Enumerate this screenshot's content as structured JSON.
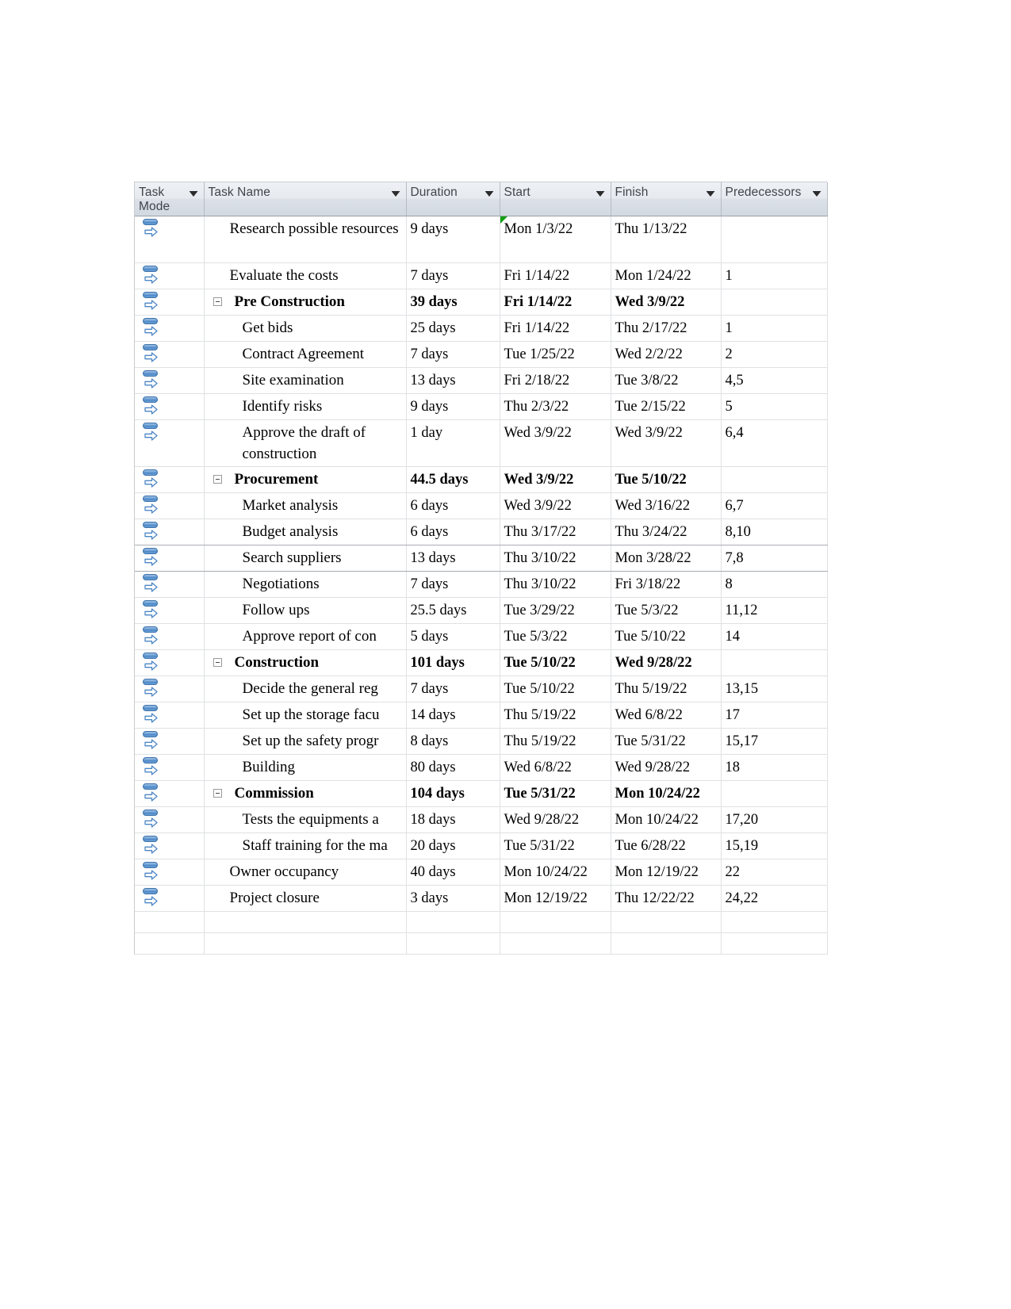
{
  "app": "microsoft-project-entry-table",
  "columns": [
    {
      "key": "mode",
      "label": "Task\nMode",
      "has_filter": true
    },
    {
      "key": "name",
      "label": "Task Name",
      "has_filter": true
    },
    {
      "key": "dur",
      "label": "Duration",
      "has_filter": true
    },
    {
      "key": "start",
      "label": "Start",
      "has_filter": true
    },
    {
      "key": "fin",
      "label": "Finish",
      "has_filter": true
    },
    {
      "key": "pred",
      "label": "Predecessors",
      "has_filter": true
    }
  ],
  "colors": {
    "header_bg": "#dde2e9",
    "header_text": "#40454c",
    "grid_line": "#dfe1e4",
    "icon_blue": "#4d87c6",
    "flag_green": "#11a011"
  },
  "icons": {
    "task_mode": "auto-scheduled-icon",
    "filter": "filter-dropdown-arrow-icon",
    "collapse": "collapse-minus-box-icon",
    "indicator": "green-corner-indicator"
  },
  "rows": [
    {
      "name": "Research possible resources",
      "level": 1,
      "summary": false,
      "wrap": true,
      "dur": "9 days",
      "start": "Mon 1/3/22",
      "finish": "Thu 1/13/22",
      "pred": "",
      "flag": true
    },
    {
      "name": "Evaluate the costs",
      "level": 1,
      "summary": false,
      "wrap": false,
      "dur": "7 days",
      "start": "Fri 1/14/22",
      "finish": "Mon 1/24/22",
      "pred": "1",
      "flag": false
    },
    {
      "name": "Pre Construction",
      "level": 0,
      "summary": true,
      "wrap": false,
      "dur": "39 days",
      "start": "Fri 1/14/22",
      "finish": "Wed 3/9/22",
      "pred": "",
      "flag": false
    },
    {
      "name": "Get bids",
      "level": 2,
      "summary": false,
      "wrap": false,
      "dur": "25 days",
      "start": "Fri 1/14/22",
      "finish": "Thu 2/17/22",
      "pred": "1",
      "flag": false
    },
    {
      "name": "Contract Agreement",
      "level": 2,
      "summary": false,
      "wrap": false,
      "dur": "7 days",
      "start": "Tue 1/25/22",
      "finish": "Wed 2/2/22",
      "pred": "2",
      "flag": false
    },
    {
      "name": "Site examination",
      "level": 2,
      "summary": false,
      "wrap": false,
      "dur": "13 days",
      "start": "Fri 2/18/22",
      "finish": "Tue 3/8/22",
      "pred": "4,5",
      "flag": false
    },
    {
      "name": "Identify risks",
      "level": 2,
      "summary": false,
      "wrap": false,
      "dur": "9 days",
      "start": "Thu 2/3/22",
      "finish": "Tue 2/15/22",
      "pred": "5",
      "flag": false
    },
    {
      "name": "Approve the draft of construction",
      "level": 2,
      "summary": false,
      "wrap": true,
      "dur": "1 day",
      "start": "Wed 3/9/22",
      "finish": "Wed 3/9/22",
      "pred": "6,4",
      "flag": false
    },
    {
      "name": "Procurement",
      "level": 0,
      "summary": true,
      "wrap": false,
      "dur": "44.5 days",
      "start": "Wed 3/9/22",
      "finish": "Tue 5/10/22",
      "pred": "",
      "flag": false
    },
    {
      "name": "Market analysis",
      "level": 2,
      "summary": false,
      "wrap": false,
      "dur": "6 days",
      "start": "Wed 3/9/22",
      "finish": "Wed 3/16/22",
      "pred": "6,7",
      "flag": false
    },
    {
      "name": "Budget analysis",
      "level": 2,
      "summary": false,
      "wrap": false,
      "dur": "6 days",
      "start": "Thu 3/17/22",
      "finish": "Thu 3/24/22",
      "pred": "8,10",
      "flag": false
    },
    {
      "name": "Search suppliers",
      "level": 2,
      "summary": false,
      "wrap": false,
      "dur": "13 days",
      "start": "Thu 3/10/22",
      "finish": "Mon 3/28/22",
      "pred": "7,8",
      "flag": false
    },
    {
      "name": "Negotiations",
      "level": 2,
      "summary": false,
      "wrap": false,
      "dur": "7 days",
      "start": "Thu 3/10/22",
      "finish": "Fri 3/18/22",
      "pred": "8",
      "flag": false
    },
    {
      "name": "Follow ups",
      "level": 2,
      "summary": false,
      "wrap": false,
      "dur": "25.5 days",
      "start": "Tue 3/29/22",
      "finish": "Tue 5/3/22",
      "pred": "11,12",
      "flag": false
    },
    {
      "name": "Approve report of con",
      "level": 2,
      "summary": false,
      "wrap": false,
      "dur": "5 days",
      "start": "Tue 5/3/22",
      "finish": "Tue 5/10/22",
      "pred": "14",
      "flag": false
    },
    {
      "name": "Construction",
      "level": 0,
      "summary": true,
      "wrap": false,
      "dur": "101 days",
      "start": "Tue 5/10/22",
      "finish": "Wed 9/28/22",
      "pred": "",
      "flag": false
    },
    {
      "name": "Decide the general reg",
      "level": 2,
      "summary": false,
      "wrap": false,
      "dur": "7 days",
      "start": "Tue 5/10/22",
      "finish": "Thu 5/19/22",
      "pred": "13,15",
      "flag": false
    },
    {
      "name": "Set up the storage facu",
      "level": 2,
      "summary": false,
      "wrap": false,
      "dur": "14 days",
      "start": "Thu 5/19/22",
      "finish": "Wed 6/8/22",
      "pred": "17",
      "flag": false
    },
    {
      "name": "Set up the safety progr",
      "level": 2,
      "summary": false,
      "wrap": false,
      "dur": "8 days",
      "start": "Thu 5/19/22",
      "finish": "Tue 5/31/22",
      "pred": "15,17",
      "flag": false
    },
    {
      "name": "Building",
      "level": 2,
      "summary": false,
      "wrap": false,
      "dur": "80 days",
      "start": "Wed 6/8/22",
      "finish": "Wed 9/28/22",
      "pred": "18",
      "flag": false
    },
    {
      "name": "Commission",
      "level": 0,
      "summary": true,
      "wrap": false,
      "dur": "104 days",
      "start": "Tue 5/31/22",
      "finish": "Mon 10/24/22",
      "pred": "",
      "flag": false
    },
    {
      "name": "Tests the equipments a",
      "level": 2,
      "summary": false,
      "wrap": false,
      "dur": "18 days",
      "start": "Wed 9/28/22",
      "finish": "Mon 10/24/22",
      "pred": "17,20",
      "flag": false
    },
    {
      "name": "Staff training for the ma",
      "level": 2,
      "summary": false,
      "wrap": false,
      "dur": "20 days",
      "start": "Tue 5/31/22",
      "finish": "Tue 6/28/22",
      "pred": "15,19",
      "flag": false
    },
    {
      "name": "Owner occupancy",
      "level": 1,
      "summary": false,
      "wrap": false,
      "dur": "40 days",
      "start": "Mon 10/24/22",
      "finish": "Mon 12/19/22",
      "pred": "22",
      "flag": false
    },
    {
      "name": "Project closure",
      "level": 1,
      "summary": false,
      "wrap": false,
      "dur": "3 days",
      "start": "Mon 12/19/22",
      "finish": "Thu 12/22/22",
      "pred": "24,22",
      "flag": false
    }
  ],
  "blank_rows": 2
}
